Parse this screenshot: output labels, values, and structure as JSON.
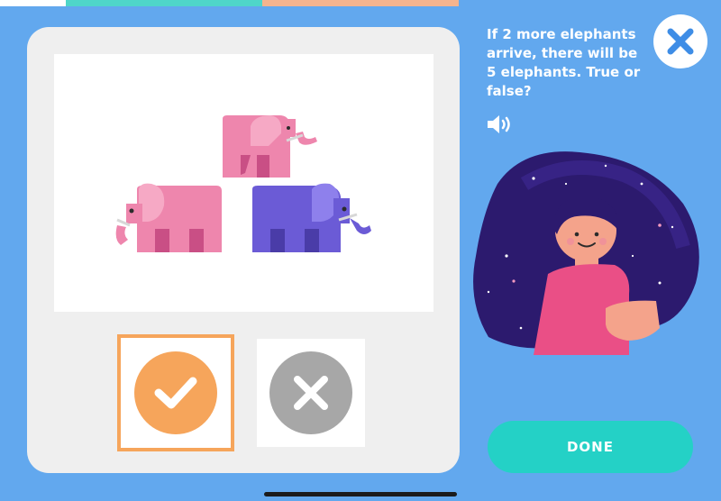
{
  "progress": {
    "segments": 4,
    "current": 1
  },
  "question": {
    "text": "If 2 more elephants arrive, there will be 5 elephants. True or false?"
  },
  "picture": {
    "elephant_count": 3,
    "elephant_colors": [
      "#ee86ad",
      "#ee86ad",
      "#6b5bd6"
    ]
  },
  "answers": {
    "true_icon": "check-icon",
    "false_icon": "x-icon",
    "selected": "true"
  },
  "controls": {
    "done_label": "DONE",
    "close_icon": "close-icon",
    "audio_icon": "speaker-icon"
  },
  "colors": {
    "background": "#62a8ee",
    "accent_orange": "#f6a55b",
    "accent_teal": "#24d1c6",
    "close_blue": "#3e8de6"
  }
}
